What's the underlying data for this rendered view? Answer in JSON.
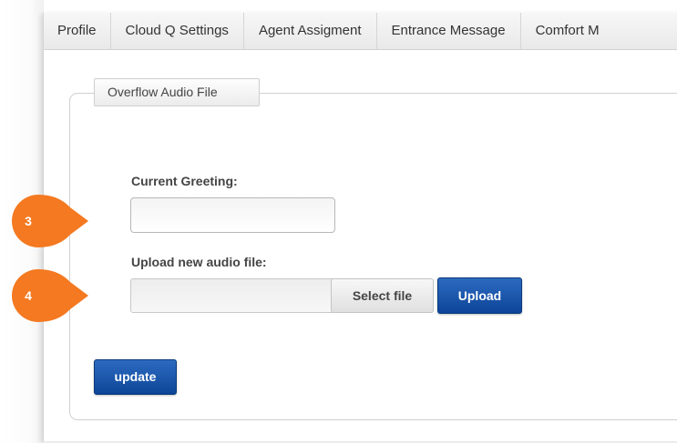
{
  "tabs": [
    {
      "label": "Profile"
    },
    {
      "label": "Cloud Q Settings"
    },
    {
      "label": "Agent Assigment"
    },
    {
      "label": "Entrance Message"
    },
    {
      "label": "Comfort M"
    }
  ],
  "section": {
    "legend": "Overflow Audio File"
  },
  "current_greeting": {
    "label": "Current Greeting:",
    "value": ""
  },
  "upload": {
    "label": "Upload new audio file:",
    "file_value": "",
    "select_label": "Select file",
    "upload_label": "Upload"
  },
  "update_label": "update",
  "markers": [
    {
      "number": "3",
      "color": "#f47920"
    },
    {
      "number": "4",
      "color": "#f47920"
    }
  ]
}
